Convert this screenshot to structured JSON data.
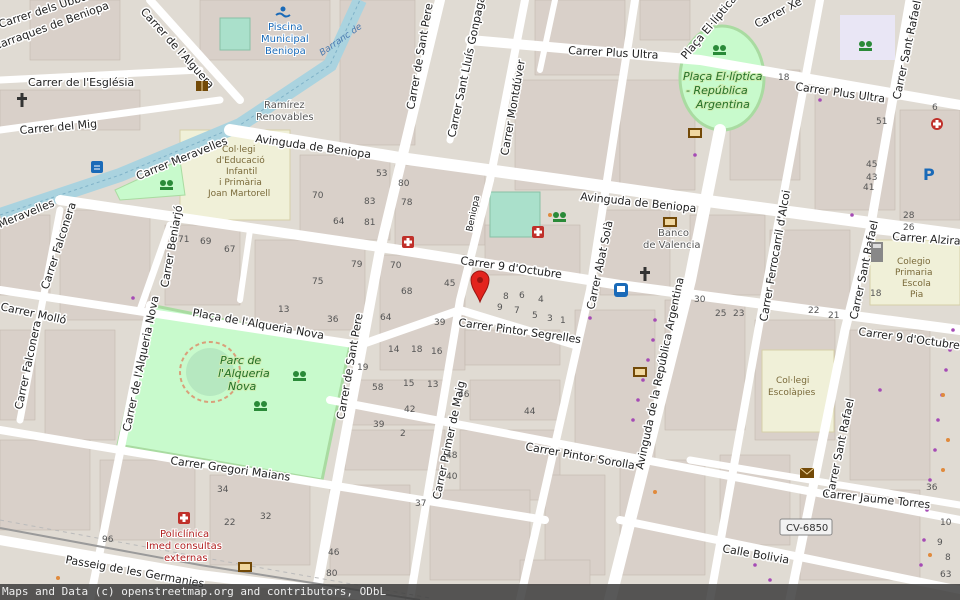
{
  "map": {
    "streets": {
      "carrer_dels_ubba": "Carrer dels Ubba",
      "carraques": "Carraques de Beniopa",
      "carrer_de_l_alguera": "Carrer de l'Alguera",
      "carrer_esglesia": "Carrer de l'Església",
      "carrer_del_mig": "Carrer del Mig",
      "carrer_meravelles_1": "Carrer Meravelles",
      "carrer_meravelles_2": "Meravelles",
      "avinguda_beniopa_1": "Avinguda de Beniopa",
      "avinguda_beniopa_2": "Avinguda de Beniopa",
      "carrer_falconera_1": "Carrer Falconera",
      "carrer_falconera_2": "Carrer Falconera",
      "carrer_mollo": "Carrer Molló",
      "carrer_beniarjo": "Carrer Beniarjó",
      "carrer_alqueria_nova": "Carrer de l'Alqueria Nova",
      "placa_alqueria_nova": "Plaça de l'Alqueria Nova",
      "carrer_sant_pere_1": "Carrer de Sant Pere",
      "carrer_sant_pere_2": "Carrer de Sant Pere",
      "carrer_sant_lluis_gonpaga": "Carrer Sant Lluís Gonpaga",
      "carrer_montduver": "Carrer Montdúver",
      "carrer_plus_ultra_1": "Carrer Plus Ultra",
      "carrer_plus_ultra_2": "Carrer Plus Ultra",
      "carrer_xeraco": "Carrer Xe",
      "carrer_9_octubre_1": "Carrer 9 d'Octubre",
      "carrer_9_octubre_2": "Carrer 9 d'Octubre",
      "carrer_pintor_segrelles": "Carrer Pintor Segrelles",
      "carrer_abat_sola": "Carrer Abat Solà",
      "beniopa_small": "Beniopa",
      "avinguda_republica_argentina": "Avinguda de la República Argentina",
      "carrer_ferrocarril_alcoi": "Carrer Ferrocarril d'Alcoi",
      "carrer_sant_rafael_1": "Carrer Sant Rafael",
      "carrer_sant_rafael_2": "Carrer Sant Rafael",
      "carrer_sant_rafael_3": "Carrer Sant Rafael",
      "carrer_alzira": "Carrer Alzira",
      "carrer_primer_de_maig": "Carrer Primer de Maig",
      "carrer_pintor_sorolla": "Carrer Pintor Sorolla",
      "carrer_gregori_maians": "Carrer Gregori Maians",
      "carrer_jaume_torres": "Carrer Jaume Torres",
      "calle_bolivia": "Calle Bolivia",
      "passeig_germanies": "Passeig de les Germanies",
      "placa_eliptica": "Plaça El·líptica"
    },
    "places": {
      "piscina_1": "Piscina",
      "piscina_2": "Municipal",
      "piscina_3": "Beniopa",
      "barranc": "Barranc de",
      "ramirez_1": "Ramírez",
      "ramirez_2": "Renovables",
      "colegi_1": "Col·legi",
      "colegi_2": "d'Educació",
      "colegi_3": "Infantil",
      "colegi_4": "i Primària",
      "colegi_5": "Joan Martorell",
      "parc_1": "Parc de",
      "parc_2": "l'Alqueria",
      "parc_3": "Nova",
      "placa_el_1": "Plaça El·líptica",
      "placa_el_2": "- República",
      "placa_el_3": "Argentina",
      "banco_1": "Banco",
      "banco_2": "de Valencia",
      "escolapies_1": "Col·legi",
      "escolapies_2": "Escolàpies",
      "colegio_pia_1": "Colegio",
      "colegio_pia_2": "Primaria",
      "colegio_pia_3": "Escola",
      "colegio_pia_4": "Pia",
      "policlinica_1": "Policlínica",
      "policlinica_2": "Imed consultas",
      "policlinica_3": "externas",
      "road_ref": "CV-6850"
    },
    "house_numbers": [
      "53",
      "80",
      "70",
      "83",
      "64",
      "81",
      "78",
      "71",
      "69",
      "67",
      "79",
      "70",
      "68",
      "45",
      "75",
      "13",
      "36",
      "64",
      "8",
      "6",
      "4",
      "9",
      "7",
      "5",
      "3",
      "1",
      "39",
      "18",
      "16",
      "14",
      "19",
      "58",
      "15",
      "13",
      "46",
      "42",
      "44",
      "39",
      "2",
      "48",
      "40",
      "37",
      "34",
      "22",
      "32",
      "46",
      "80",
      "96",
      "30",
      "25",
      "23",
      "22",
      "21",
      "18",
      "51",
      "45",
      "43",
      "41",
      "28",
      "26",
      "6",
      "18",
      "36",
      "10",
      "9",
      "8",
      "63"
    ],
    "colors": {
      "land": "#e0dbd3",
      "building": "#d9d0c9",
      "road": "#ffffff",
      "park": "#c8facc",
      "park_dark": "#a9dba1",
      "water": "#aad3df",
      "school": "#f0f0d8",
      "marker": "#e3241e"
    },
    "marker_icon": "map-pin-icon"
  },
  "attribution": "Maps and Data (c) openstreetmap.org and contributors, ODbL"
}
